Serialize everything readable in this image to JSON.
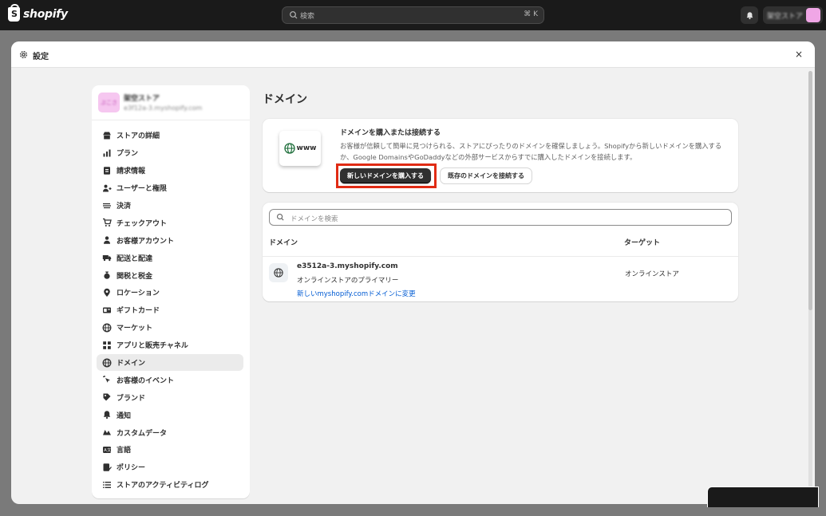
{
  "app": {
    "logo_text": "shopify",
    "search_placeholder": "検索",
    "search_shortcut": "⌘ K",
    "account_name": "架空ストア"
  },
  "modal": {
    "title": "設定",
    "close_label": "×"
  },
  "store": {
    "avatar_text": "ぷこさ",
    "name": "架空ストア",
    "url": "e3f12a-3.myshopify.com"
  },
  "sidebar": {
    "items": [
      {
        "label": "ストアの詳細",
        "icon": "store-icon"
      },
      {
        "label": "プラン",
        "icon": "plan-chart-icon"
      },
      {
        "label": "請求情報",
        "icon": "billing-icon"
      },
      {
        "label": "ユーザーと権限",
        "icon": "users-icon"
      },
      {
        "label": "決済",
        "icon": "payments-icon"
      },
      {
        "label": "チェックアウト",
        "icon": "cart-icon"
      },
      {
        "label": "お客様アカウント",
        "icon": "person-icon"
      },
      {
        "label": "配送と配達",
        "icon": "truck-icon"
      },
      {
        "label": "関税と税金",
        "icon": "tax-bag-icon"
      },
      {
        "label": "ロケーション",
        "icon": "location-pin-icon"
      },
      {
        "label": "ギフトカード",
        "icon": "gift-card-icon"
      },
      {
        "label": "マーケット",
        "icon": "globe-icon"
      },
      {
        "label": "アプリと販売チャネル",
        "icon": "apps-icon"
      },
      {
        "label": "ドメイン",
        "icon": "globe-icon",
        "active": true
      },
      {
        "label": "お客様のイベント",
        "icon": "cursor-click-icon"
      },
      {
        "label": "ブランド",
        "icon": "brand-icon"
      },
      {
        "label": "通知",
        "icon": "bell-icon"
      },
      {
        "label": "カスタムデータ",
        "icon": "custom-data-icon"
      },
      {
        "label": "言語",
        "icon": "language-icon"
      },
      {
        "label": "ポリシー",
        "icon": "policy-icon"
      },
      {
        "label": "ストアのアクティビティログ",
        "icon": "activity-list-icon"
      }
    ]
  },
  "main": {
    "page_title": "ドメイン",
    "buy_card": {
      "badge_text": "www",
      "title": "ドメインを購入または接続する",
      "description": "お客様が信頼して簡単に見つけられる、ストアにぴったりのドメインを確保しましょう。Shopifyから新しいドメインを購入するか、Google DomainsやGoDaddyなどの外部サービスからすでに購入したドメインを接続します。",
      "primary_button": "新しいドメインを購入する",
      "secondary_button": "既存のドメインを接続する"
    },
    "domains_card": {
      "search_placeholder": "ドメインを検索",
      "col_domain": "ドメイン",
      "col_target": "ターゲット",
      "rows": [
        {
          "domain": "e3512a-3.myshopify.com",
          "subtitle": "オンラインストアのプライマリー",
          "link": "新しいmyshopify.comドメインに変更",
          "target": "オンラインストア"
        }
      ]
    }
  },
  "colors": {
    "topbar": "#1a1a1a",
    "highlight": "#e02b14",
    "link": "#005bd3",
    "primary_button": "#303030"
  }
}
